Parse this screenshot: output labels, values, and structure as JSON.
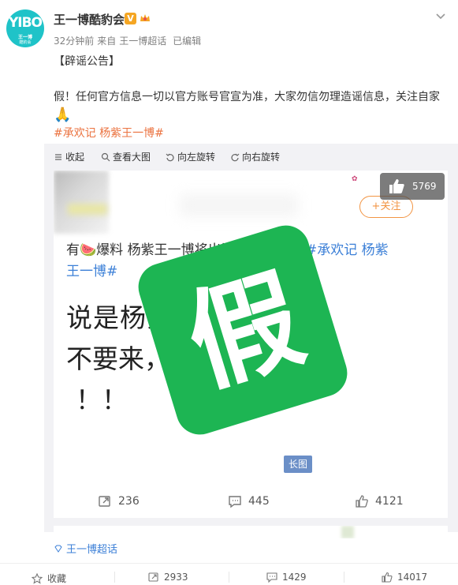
{
  "author": {
    "name": "王一博酷豹会",
    "avatar_text": "YIBO",
    "avatar_sub1": "王一博",
    "avatar_sub2": "酷豹会"
  },
  "meta": {
    "time": "32分钟前",
    "source_prefix": "来自",
    "source": "王一博超话",
    "edited": "已编辑"
  },
  "post": {
    "line1": "【辟谣公告】",
    "line2": "假！任何官方信息一切以官方账号官宣为准，大家勿信勿理造谣信息，关注自家",
    "line3_emoji": "🙏",
    "hashtags": "#承欢记 杨紫王一博#"
  },
  "toolbar": {
    "collapse": "收起",
    "view_large": "查看大图",
    "rotate_left": "向左旋转",
    "rotate_right": "向右旋转"
  },
  "image": {
    "follow_label": "+关注",
    "line1_prefix": "有🍉爆料 杨紫王一博将出演《承欢记》",
    "line1_tag": "#承欢记 杨紫",
    "line2_tag": "王一博#",
    "big_line1": "说是杨紫&王一博 ",
    "big_line2": "不要来，暂",
    "big_line3": "！！",
    "stamp_char": "假",
    "long_image_label": "长图",
    "like_badge": "5769",
    "repost_count": "236",
    "comment_count": "445",
    "like_count": "4121"
  },
  "topic": {
    "label": "王一博超话"
  },
  "bottom_bar": {
    "favorite": "收藏",
    "reposts": "2933",
    "comments": "1429",
    "likes": "14017"
  },
  "colors": {
    "accent_orange": "#eb7340",
    "link_blue": "#3b7fd7",
    "stamp_green": "#1db553",
    "avatar_teal": "#1fc3c8"
  }
}
